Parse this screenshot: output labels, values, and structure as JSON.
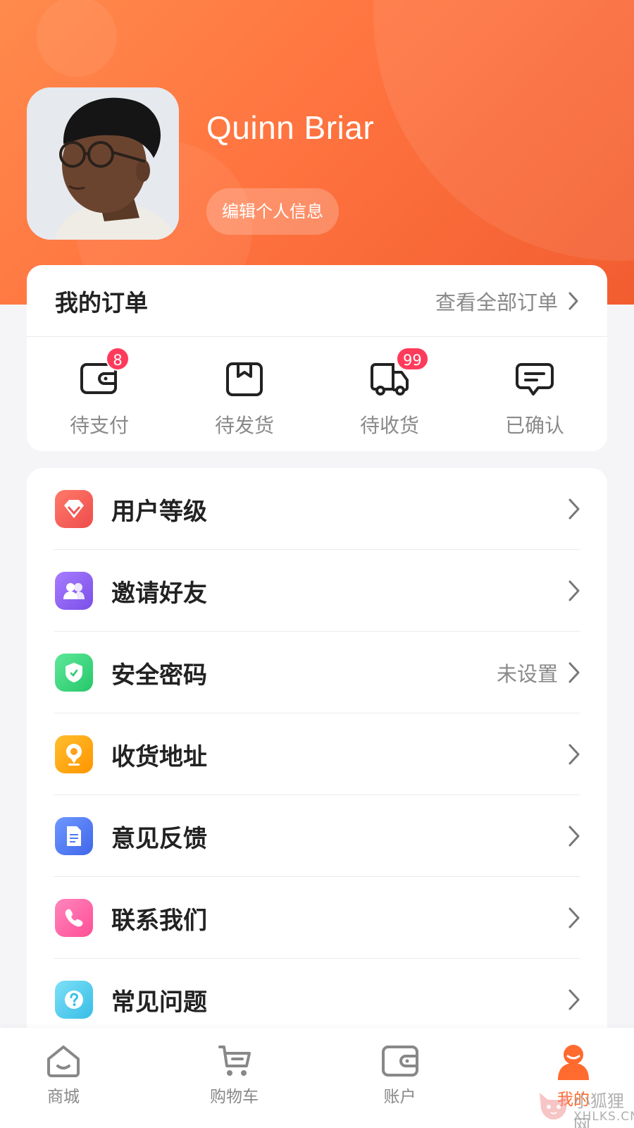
{
  "profile": {
    "name": "Quinn Briar",
    "edit_label": "编辑个人信息"
  },
  "orders": {
    "title": "我的订单",
    "view_all": "查看全部订单",
    "items": [
      {
        "label": "待支付",
        "badge": "8",
        "icon": "wallet-icon"
      },
      {
        "label": "待发货",
        "badge": "",
        "icon": "package-icon"
      },
      {
        "label": "待收货",
        "badge": "99",
        "icon": "truck-icon"
      },
      {
        "label": "已确认",
        "badge": "",
        "icon": "message-icon"
      }
    ]
  },
  "menu": {
    "items": [
      {
        "label": "用户等级",
        "value": "",
        "icon": "diamond-icon",
        "color": "#f25858"
      },
      {
        "label": "邀请好友",
        "value": "",
        "icon": "users-icon",
        "color": "#8a5cf0"
      },
      {
        "label": "安全密码",
        "value": "未设置",
        "icon": "shield-icon",
        "color": "#34d27a"
      },
      {
        "label": "收货地址",
        "value": "",
        "icon": "location-icon",
        "color": "#ffa11a"
      },
      {
        "label": "意见反馈",
        "value": "",
        "icon": "document-icon",
        "color": "#4f7cf5"
      },
      {
        "label": "联系我们",
        "value": "",
        "icon": "phone-icon",
        "color": "#ff5fa2"
      },
      {
        "label": "常见问题",
        "value": "",
        "icon": "question-icon",
        "color": "#46c8ec"
      }
    ]
  },
  "tabbar": {
    "items": [
      {
        "label": "商城",
        "icon": "home-icon",
        "active": false
      },
      {
        "label": "购物车",
        "icon": "cart-icon",
        "active": false
      },
      {
        "label": "账户",
        "icon": "wallet-icon",
        "active": false
      },
      {
        "label": "我的",
        "icon": "user-icon",
        "active": true
      }
    ]
  },
  "watermark": {
    "line1": "小狐狸网",
    "line2": "XHLKS.CN"
  },
  "colors": {
    "brand": "#ff7440",
    "badge": "#ff3b5c",
    "tab_active": "#ff6a2e"
  }
}
